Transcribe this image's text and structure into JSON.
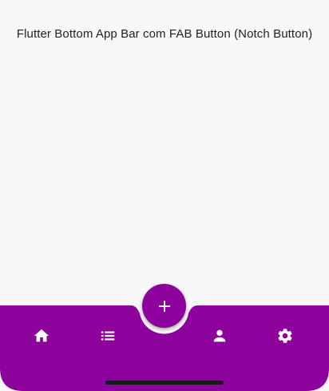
{
  "main": {
    "title": "Flutter Bottom App Bar com FAB Button (Notch Button)"
  },
  "bottom_app_bar": {
    "color": "#8d019c",
    "icon_color": "#ffffff",
    "items": [
      {
        "icon": "home-icon"
      },
      {
        "icon": "list-icon"
      },
      {
        "icon": "person-icon"
      },
      {
        "icon": "gear-icon"
      }
    ]
  },
  "fab": {
    "icon": "plus-icon",
    "color": "#8d019c"
  }
}
